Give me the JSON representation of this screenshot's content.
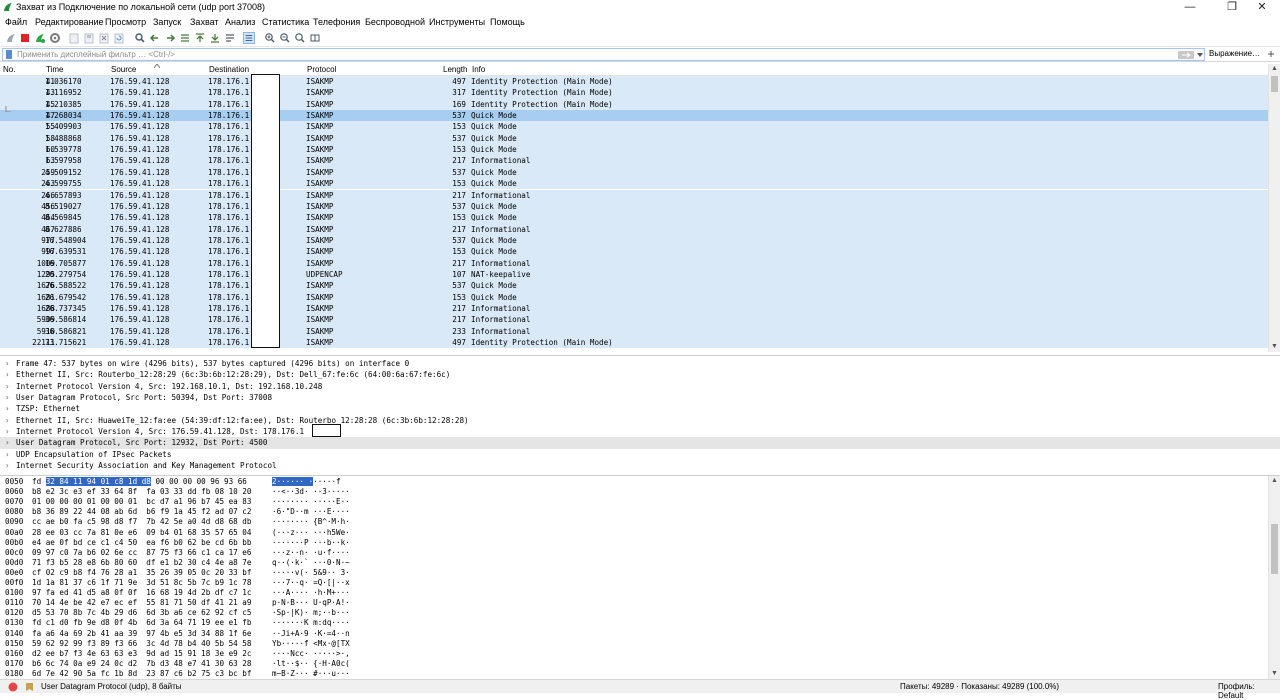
{
  "window": {
    "title": "Захват из Подключение по локальной сети (udp port 37008)",
    "minimize": "—",
    "maximize": "❐",
    "close": "✕"
  },
  "menu": [
    "Файл",
    "Редактирование",
    "Просмотр",
    "Запуск",
    "Захват",
    "Анализ",
    "Статистика",
    "Телефония",
    "Беспроводной",
    "Инструменты",
    "Помощь"
  ],
  "filter": {
    "placeholder": "Применить дисплейный фильтр … <Ctrl-/>",
    "expression_label": "Выражение…"
  },
  "packet_list": {
    "columns": [
      "No.",
      "Time",
      "Source",
      "Destination",
      "Protocol",
      "Length",
      "Info"
    ],
    "rows": [
      [
        "41",
        "1.036170",
        "176.59.41.128",
        "178.176.1",
        "ISAKMP",
        "497",
        "Identity Protection (Main Mode)"
      ],
      [
        "43",
        "1.116952",
        "176.59.41.128",
        "178.176.1",
        "ISAKMP",
        "317",
        "Identity Protection (Main Mode)"
      ],
      [
        "45",
        "1.210385",
        "176.59.41.128",
        "178.176.1",
        "ISAKMP",
        "169",
        "Identity Protection (Main Mode)"
      ],
      [
        "47",
        "1.268034",
        "176.59.41.128",
        "178.176.1",
        "ISAKMP",
        "537",
        "Quick Mode"
      ],
      [
        "55",
        "1.409903",
        "176.59.41.128",
        "178.176.1",
        "ISAKMP",
        "153",
        "Quick Mode"
      ],
      [
        "58",
        "1.488868",
        "176.59.41.128",
        "178.176.1",
        "ISAKMP",
        "537",
        "Quick Mode"
      ],
      [
        "60",
        "1.539778",
        "176.59.41.128",
        "178.176.1",
        "ISAKMP",
        "153",
        "Quick Mode"
      ],
      [
        "63",
        "1.597958",
        "176.59.41.128",
        "178.176.1",
        "ISAKMP",
        "217",
        "Informational"
      ],
      [
        "259",
        "4.509152",
        "176.59.41.128",
        "178.176.1",
        "ISAKMP",
        "537",
        "Quick Mode"
      ],
      [
        "263",
        "4.599755",
        "176.59.41.128",
        "178.176.1",
        "ISAKMP",
        "153",
        "Quick Mode"
      ],
      [
        "266",
        "4.657893",
        "176.59.41.128",
        "178.176.1",
        "ISAKMP",
        "217",
        "Informational"
      ],
      [
        "456",
        "8.519027",
        "176.59.41.128",
        "178.176.1",
        "ISAKMP",
        "537",
        "Quick Mode"
      ],
      [
        "464",
        "8.569845",
        "176.59.41.128",
        "178.176.1",
        "ISAKMP",
        "153",
        "Quick Mode"
      ],
      [
        "467",
        "8.627886",
        "176.59.41.128",
        "178.176.1",
        "ISAKMP",
        "217",
        "Informational"
      ],
      [
        "977",
        "16.548904",
        "176.59.41.128",
        "178.176.1",
        "ISAKMP",
        "537",
        "Quick Mode"
      ],
      [
        "997",
        "16.639531",
        "176.59.41.128",
        "178.176.1",
        "ISAKMP",
        "153",
        "Quick Mode"
      ],
      [
        "1009",
        "16.705877",
        "176.59.41.128",
        "178.176.1",
        "ISAKMP",
        "217",
        "Informational"
      ],
      [
        "1295",
        "20.279754",
        "176.59.41.128",
        "178.176.1",
        "UDPENCAP",
        "107",
        "NAT-keepalive"
      ],
      [
        "1676",
        "26.588522",
        "176.59.41.128",
        "178.176.1",
        "ISAKMP",
        "537",
        "Quick Mode"
      ],
      [
        "1681",
        "26.679542",
        "176.59.41.128",
        "178.176.1",
        "ISAKMP",
        "153",
        "Quick Mode"
      ],
      [
        "1688",
        "26.737345",
        "176.59.41.128",
        "178.176.1",
        "ISAKMP",
        "217",
        "Informational"
      ],
      [
        "5909",
        "36.586814",
        "176.59.41.128",
        "178.176.1",
        "ISAKMP",
        "217",
        "Informational"
      ],
      [
        "5910",
        "36.586821",
        "176.59.41.128",
        "178.176.1",
        "ISAKMP",
        "233",
        "Informational"
      ],
      [
        "22111",
        "73.715621",
        "176.59.41.128",
        "178.176.1",
        "ISAKMP",
        "497",
        "Identity Protection (Main Mode)"
      ]
    ],
    "selected_index": 3
  },
  "details": [
    "Frame 47: 537 bytes on wire (4296 bits), 537 bytes captured (4296 bits) on interface 0",
    "Ethernet II, Src: Routerbo_12:28:29 (6c:3b:6b:12:28:29), Dst: Dell_67:fe:6c (64:00:6a:67:fe:6c)",
    "Internet Protocol Version 4, Src: 192.168.10.1, Dst: 192.168.10.248",
    "User Datagram Protocol, Src Port: 50394, Dst Port: 37008",
    "TZSP: Ethernet",
    "Ethernet II, Src: HuaweiTe_12:fa:ee (54:39:df:12:fa:ee), Dst: Routerbo_12:28:28 (6c:3b:6b:12:28:28)",
    "Internet Protocol Version 4, Src: 176.59.41.128, Dst: 178.176.1",
    "User Datagram Protocol, Src Port: 12932, Dst Port: 4500",
    "UDP Encapsulation of IPsec Packets",
    "Internet Security Association and Key Management Protocol"
  ],
  "details_highlight_index": 7,
  "hexdump": [
    {
      "off": "0050",
      "pre": "fd ",
      "sel": "32 84 11 94 01 c8 1d d8",
      "post": " 00 00 00 00 96 93 66",
      "apre": "",
      "asel": "2······ ·",
      "apost": "·····f"
    },
    {
      "off": "0060",
      "pre": "b8 e2 3c e3 ef 33 64 8f  fa 03 33 dd fb 08 10 20",
      "sel": "",
      "post": "",
      "apre": "··<··3d· ··3·····",
      "asel": "",
      "apost": ""
    },
    {
      "off": "0070",
      "pre": "01 00 00 00 01 00 00 01  bc d7 a1 96 b7 45 ea 83",
      "sel": "",
      "post": "",
      "apre": "········ ·····E··",
      "asel": "",
      "apost": ""
    },
    {
      "off": "0080",
      "pre": "b8 36 89 22 44 08 ab 6d  b6 f9 1a 45 f2 ad 07 c2",
      "sel": "",
      "post": "",
      "apre": "·6·\"D··m ···E····",
      "asel": "",
      "apost": ""
    },
    {
      "off": "0090",
      "pre": "cc ae b0 fa c5 98 d8 f7  7b 42 5e a0 4d d8 68 db",
      "sel": "",
      "post": "",
      "apre": "········ {B^·M·h·",
      "asel": "",
      "apost": ""
    },
    {
      "off": "00a0",
      "pre": "28 ee 03 cc 7a 81 0e e6  09 b4 01 68 35 57 65 04",
      "sel": "",
      "post": "",
      "apre": "(···z··· ···h5We·",
      "asel": "",
      "apost": ""
    },
    {
      "off": "00b0",
      "pre": "e4 ae 0f bd ce c1 c4 50  ea f6 b0 62 be cd 6b bb",
      "sel": "",
      "post": "",
      "apre": "·······P ···b··k·",
      "asel": "",
      "apost": ""
    },
    {
      "off": "00c0",
      "pre": "09 97 c0 7a b6 02 6e cc  87 75 f3 66 c1 ca 17 e6",
      "sel": "",
      "post": "",
      "apre": "···z··n· ·u·f····",
      "asel": "",
      "apost": ""
    },
    {
      "off": "00d0",
      "pre": "71 f3 b5 28 e8 6b 80 60  df e1 b2 30 c4 4e a8 7e",
      "sel": "",
      "post": "",
      "apre": "q··(·k·` ···0·N·~",
      "asel": "",
      "apost": ""
    },
    {
      "off": "00e0",
      "pre": "cf 02 c9 b8 f4 76 28 a1  35 26 39 05 0c 20 33 bf",
      "sel": "",
      "post": "",
      "apre": "·····v(· 5&9·· 3·",
      "asel": "",
      "apost": ""
    },
    {
      "off": "00f0",
      "pre": "1d 1a 81 37 c6 1f 71 9e  3d 51 8c 5b 7c b9 1c 78",
      "sel": "",
      "post": "",
      "apre": "···7··q· =Q·[|··x",
      "asel": "",
      "apost": ""
    },
    {
      "off": "0100",
      "pre": "97 fa ed 41 d5 a8 0f 0f  16 68 19 4d 2b df c7 1c",
      "sel": "",
      "post": "",
      "apre": "···A···· ·h·M+···",
      "asel": "",
      "apost": ""
    },
    {
      "off": "0110",
      "pre": "70 14 4e be 42 e7 ec ef  55 81 71 50 df 41 21 a9",
      "sel": "",
      "post": "",
      "apre": "p·N·B··· U·qP·A!·",
      "asel": "",
      "apost": ""
    },
    {
      "off": "0120",
      "pre": "d5 53 70 8b 7c 4b 29 d6  6d 3b a6 ce 62 92 cf c5",
      "sel": "",
      "post": "",
      "apre": "·Sp·|K)· m;··b···",
      "asel": "",
      "apost": ""
    },
    {
      "off": "0130",
      "pre": "fd c1 d0 fb 9e d8 0f 4b  6d 3a 64 71 19 ee e1 fb",
      "sel": "",
      "post": "",
      "apre": "·······K m:dq····",
      "asel": "",
      "apost": ""
    },
    {
      "off": "0140",
      "pre": "fa a6 4a 69 2b 41 aa 39  97 4b e5 3d 34 88 1f 6e",
      "sel": "",
      "post": "",
      "apre": "··Ji+A·9 ·K·=4··n",
      "asel": "",
      "apost": ""
    },
    {
      "off": "0150",
      "pre": "59 62 92 99 f3 89 f3 66  3c 4d 78 b4 40 5b 54 58",
      "sel": "",
      "post": "",
      "apre": "Yb·····f <Mx·@[TX",
      "asel": "",
      "apost": ""
    },
    {
      "off": "0160",
      "pre": "d2 ee b7 f3 4e 63 63 e3  9d ad 15 91 18 3e e9 2c",
      "sel": "",
      "post": "",
      "apre": "····Ncc· ·····>·,",
      "asel": "",
      "apost": ""
    },
    {
      "off": "0170",
      "pre": "b6 6c 74 0a e9 24 0c d2  7b d3 48 e7 41 30 63 28",
      "sel": "",
      "post": "",
      "apre": "·lt··$·· {·H·A0c(",
      "asel": "",
      "apost": ""
    },
    {
      "off": "0180",
      "pre": "6d 7e 42 90 5a fc 1b 8d  23 87 c6 b2 75 c3 bc bf",
      "sel": "",
      "post": "",
      "apre": "m~B·Z··· #···u···",
      "asel": "",
      "apost": ""
    }
  ],
  "status": {
    "field_info": "User Datagram Protocol (udp), 8 байты",
    "packets": "Пакеты: 49289 · Показаны: 49289 (100.0%)",
    "profile": "Профиль: Default"
  }
}
